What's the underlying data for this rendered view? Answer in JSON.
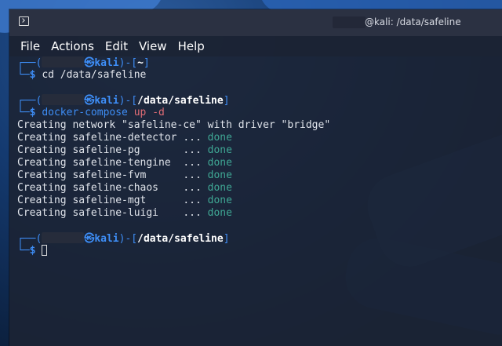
{
  "window": {
    "title": "@kali: /data/safeline"
  },
  "menu": [
    "File",
    "Actions",
    "Edit",
    "View",
    "Help"
  ],
  "prompts": [
    {
      "host": "kali",
      "path": "~",
      "command": "cd /data/safeline"
    },
    {
      "host": "kali",
      "path": "/data/safeline",
      "command_name": "docker-compose",
      "command_args": "up -d"
    },
    {
      "host": "kali",
      "path": "/data/safeline"
    }
  ],
  "symbols": {
    "at": "㉿",
    "dollar": "$",
    "box_top_open": "┌──(",
    "box_top_mid": ")-[",
    "box_top_close": "]",
    "box_bottom": "└─"
  },
  "output": {
    "network_line": "Creating network \"safeline-ce\" with driver \"bridge\"",
    "containers": [
      {
        "text": "Creating safeline-detector ... ",
        "status": "done"
      },
      {
        "text": "Creating safeline-pg       ... ",
        "status": "done"
      },
      {
        "text": "Creating safeline-tengine  ... ",
        "status": "done"
      },
      {
        "text": "Creating safeline-fvm      ... ",
        "status": "done"
      },
      {
        "text": "Creating safeline-chaos    ... ",
        "status": "done"
      },
      {
        "text": "Creating safeline-mgt      ... ",
        "status": "done"
      },
      {
        "text": "Creating safeline-luigi    ... ",
        "status": "done"
      }
    ]
  },
  "colors": {
    "prompt_accent": "#3e8ef7",
    "done_status": "#3fa794",
    "arg_highlight": "#e06c75"
  },
  "icons": {
    "window_icon": "terminal-icon"
  }
}
